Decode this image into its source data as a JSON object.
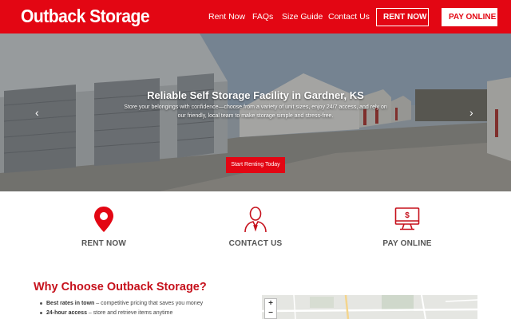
{
  "header": {
    "logo": "Outback Storage",
    "nav": [
      "Rent Now",
      "FAQs",
      "Size Guide",
      "Contact Us"
    ],
    "rent_now_button": "RENT NOW",
    "pay_online_button": "PAY ONLINE",
    "brand_color": "#e30613"
  },
  "hero": {
    "title": "Reliable Self Storage Facility in Gardner, KS",
    "subtitle": "Store your belongings with confidence—choose from a variety of unit sizes, enjoy 24/7 access, and rely on our friendly, local team to make storage simple and stress-free.",
    "cta": "Start Renting Today",
    "prev_icon": "chevron-left-icon",
    "next_icon": "chevron-right-icon",
    "prev_glyph": "‹",
    "next_glyph": "›"
  },
  "features": [
    {
      "label": "RENT NOW",
      "icon": "map-pin-icon"
    },
    {
      "label": "CONTACT US",
      "icon": "person-icon"
    },
    {
      "label": "PAY ONLINE",
      "icon": "monitor-dollar-icon"
    }
  ],
  "why": {
    "title": "Why Choose Outback Storage?",
    "items": [
      {
        "bold": "Best rates in town",
        "text": " – competitive pricing that saves you money"
      },
      {
        "bold": "24-hour access",
        "text": " – store and retrieve items anytime"
      }
    ]
  },
  "map": {
    "zoom_in": "+",
    "zoom_out": "−"
  }
}
